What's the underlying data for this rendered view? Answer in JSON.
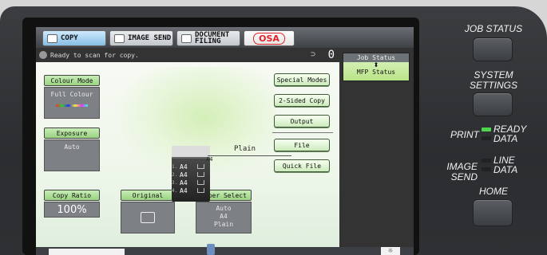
{
  "tabs": [
    {
      "label": "COPY",
      "active": true
    },
    {
      "label": "IMAGE SEND",
      "active": false
    },
    {
      "label": "DOCUMENT FILING",
      "active": false
    },
    {
      "label": "OSA",
      "active": false
    }
  ],
  "status": {
    "message": "Ready to scan for copy.",
    "copies": "0"
  },
  "functions": {
    "colour_mode": {
      "label": "Colour Mode",
      "value": "Full Colour"
    },
    "exposure": {
      "label": "Exposure",
      "value": "Auto"
    },
    "copy_ratio": {
      "label": "Copy Ratio",
      "value": "100%"
    },
    "original": {
      "label": "Original"
    },
    "paper_select": {
      "label": "Paper Select",
      "lines": [
        "Auto",
        "A4",
        "Plain"
      ]
    }
  },
  "side_buttons": [
    "Special Modes",
    "2-Sided Copy",
    "Output",
    "File",
    "Quick File"
  ],
  "preview": {
    "output_paper": "Plain",
    "output_size": "A4",
    "trays": [
      {
        "num": "1.",
        "size": "A4"
      },
      {
        "num": "2.",
        "size": "A4"
      },
      {
        "num": "3.",
        "size": "A4"
      },
      {
        "num": "4.",
        "size": "A4"
      }
    ]
  },
  "job_status_panel": {
    "title": "Job Status",
    "arrow": "⬍",
    "mode": "MFP Status"
  },
  "hardware": {
    "job_status": "JOB STATUS",
    "system_settings_1": "SYSTEM",
    "system_settings_2": "SETTINGS",
    "print": "PRINT",
    "ready": "READY",
    "data": "DATA",
    "image_send": "IMAGE SEND",
    "line": "LINE",
    "data2": "DATA",
    "home": "HOME"
  },
  "colors": {
    "ready_led": "#4cd44c",
    "screen_green": "#9ad382",
    "panel": "#2f3135"
  }
}
